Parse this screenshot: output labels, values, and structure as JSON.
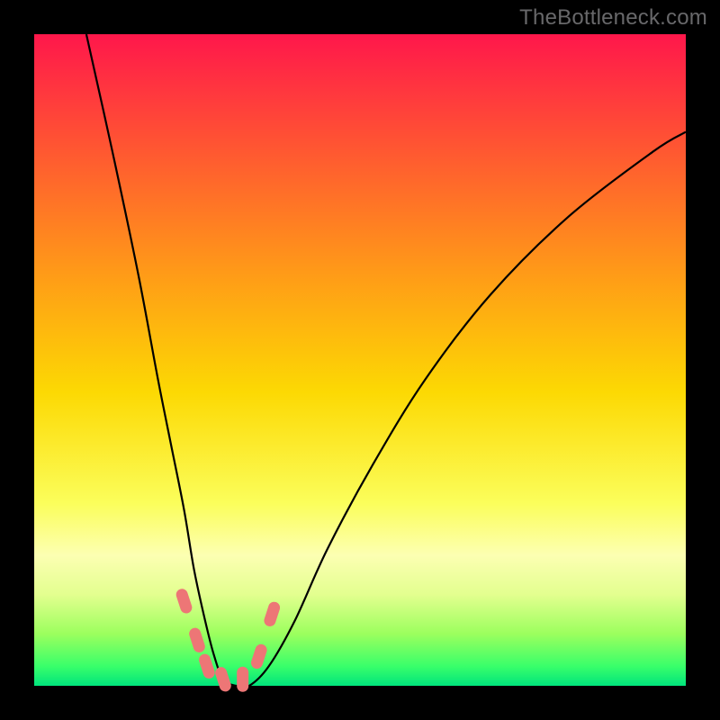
{
  "watermark": "TheBottleneck.com",
  "chart_data": {
    "type": "line",
    "title": "",
    "xlabel": "",
    "ylabel": "",
    "xlim": [
      0,
      100
    ],
    "ylim": [
      0,
      100
    ],
    "x": [
      8,
      12,
      16,
      19,
      21,
      23,
      24.5,
      26,
      27.5,
      29,
      31,
      33,
      36,
      40,
      45,
      52,
      60,
      70,
      82,
      95,
      100
    ],
    "y": [
      100,
      82,
      63,
      47,
      37,
      27,
      18,
      11,
      5,
      1,
      0,
      0,
      3,
      10,
      21,
      34,
      47,
      60,
      72,
      82,
      85
    ],
    "series_name": "bottleneck-curve",
    "markers": [
      {
        "x": 23.0,
        "y": 13.0
      },
      {
        "x": 25.0,
        "y": 7.0
      },
      {
        "x": 26.5,
        "y": 3.0
      },
      {
        "x": 29.0,
        "y": 1.0
      },
      {
        "x": 32.0,
        "y": 1.0
      },
      {
        "x": 34.5,
        "y": 4.5
      },
      {
        "x": 36.5,
        "y": 11.0
      }
    ],
    "marker_color": "#ed7676",
    "gradient_stops": [
      {
        "pos": 0,
        "color": "#ff174b"
      },
      {
        "pos": 18,
        "color": "#ff5831"
      },
      {
        "pos": 38,
        "color": "#ff9f16"
      },
      {
        "pos": 55,
        "color": "#fcd903"
      },
      {
        "pos": 72,
        "color": "#fbfe5b"
      },
      {
        "pos": 80,
        "color": "#fcffb2"
      },
      {
        "pos": 86,
        "color": "#e3ff8f"
      },
      {
        "pos": 92,
        "color": "#9cff5e"
      },
      {
        "pos": 97,
        "color": "#39ff6a"
      },
      {
        "pos": 100,
        "color": "#00e47c"
      }
    ]
  }
}
